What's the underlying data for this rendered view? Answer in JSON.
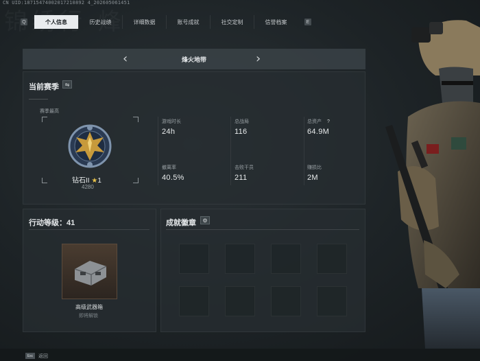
{
  "uid_text": "CN UID:18715474002017210892 4_202605061451",
  "watermark": "锦绣行·烽",
  "tabs": {
    "left_key": "Q",
    "right_key": "E",
    "items": [
      {
        "label": "个人信息",
        "active": true
      },
      {
        "label": "历史战绩",
        "active": false
      },
      {
        "label": "详细数据",
        "active": false
      },
      {
        "label": "账号成就",
        "active": false
      },
      {
        "label": "社交定制",
        "active": false
      },
      {
        "label": "信誉档案",
        "active": false
      }
    ]
  },
  "map_selector": {
    "title": "烽火地带",
    "prev": "‹",
    "next": "›"
  },
  "season": {
    "title": "当前赛季",
    "switch_icon": "swap-icon",
    "best_label": "赛季最高",
    "rank_name": "钻石II",
    "stars": "1",
    "points": "4280",
    "stats": [
      {
        "label": "游戏时长",
        "value": "24h"
      },
      {
        "label": "总战局",
        "value": "116"
      },
      {
        "label": "总资产",
        "value": "64.9M",
        "help": "?"
      },
      {
        "label": "撤离率",
        "value": "40.5%"
      },
      {
        "label": "击败干员",
        "value": "211"
      },
      {
        "label": "赚损比",
        "value": "2M"
      }
    ]
  },
  "action_level": {
    "title": "行动等级：41",
    "item_name": "高级武器箱",
    "item_sub": "即将解锁"
  },
  "achievements": {
    "title": "成就徽章",
    "settings_icon": "gear-icon",
    "slots": 8
  },
  "footer": {
    "key": "Esc",
    "label": "返回"
  },
  "colors": {
    "accent_active_tab": "#e9ecee",
    "gold": "#c79a3b",
    "panel": "#262d31"
  }
}
